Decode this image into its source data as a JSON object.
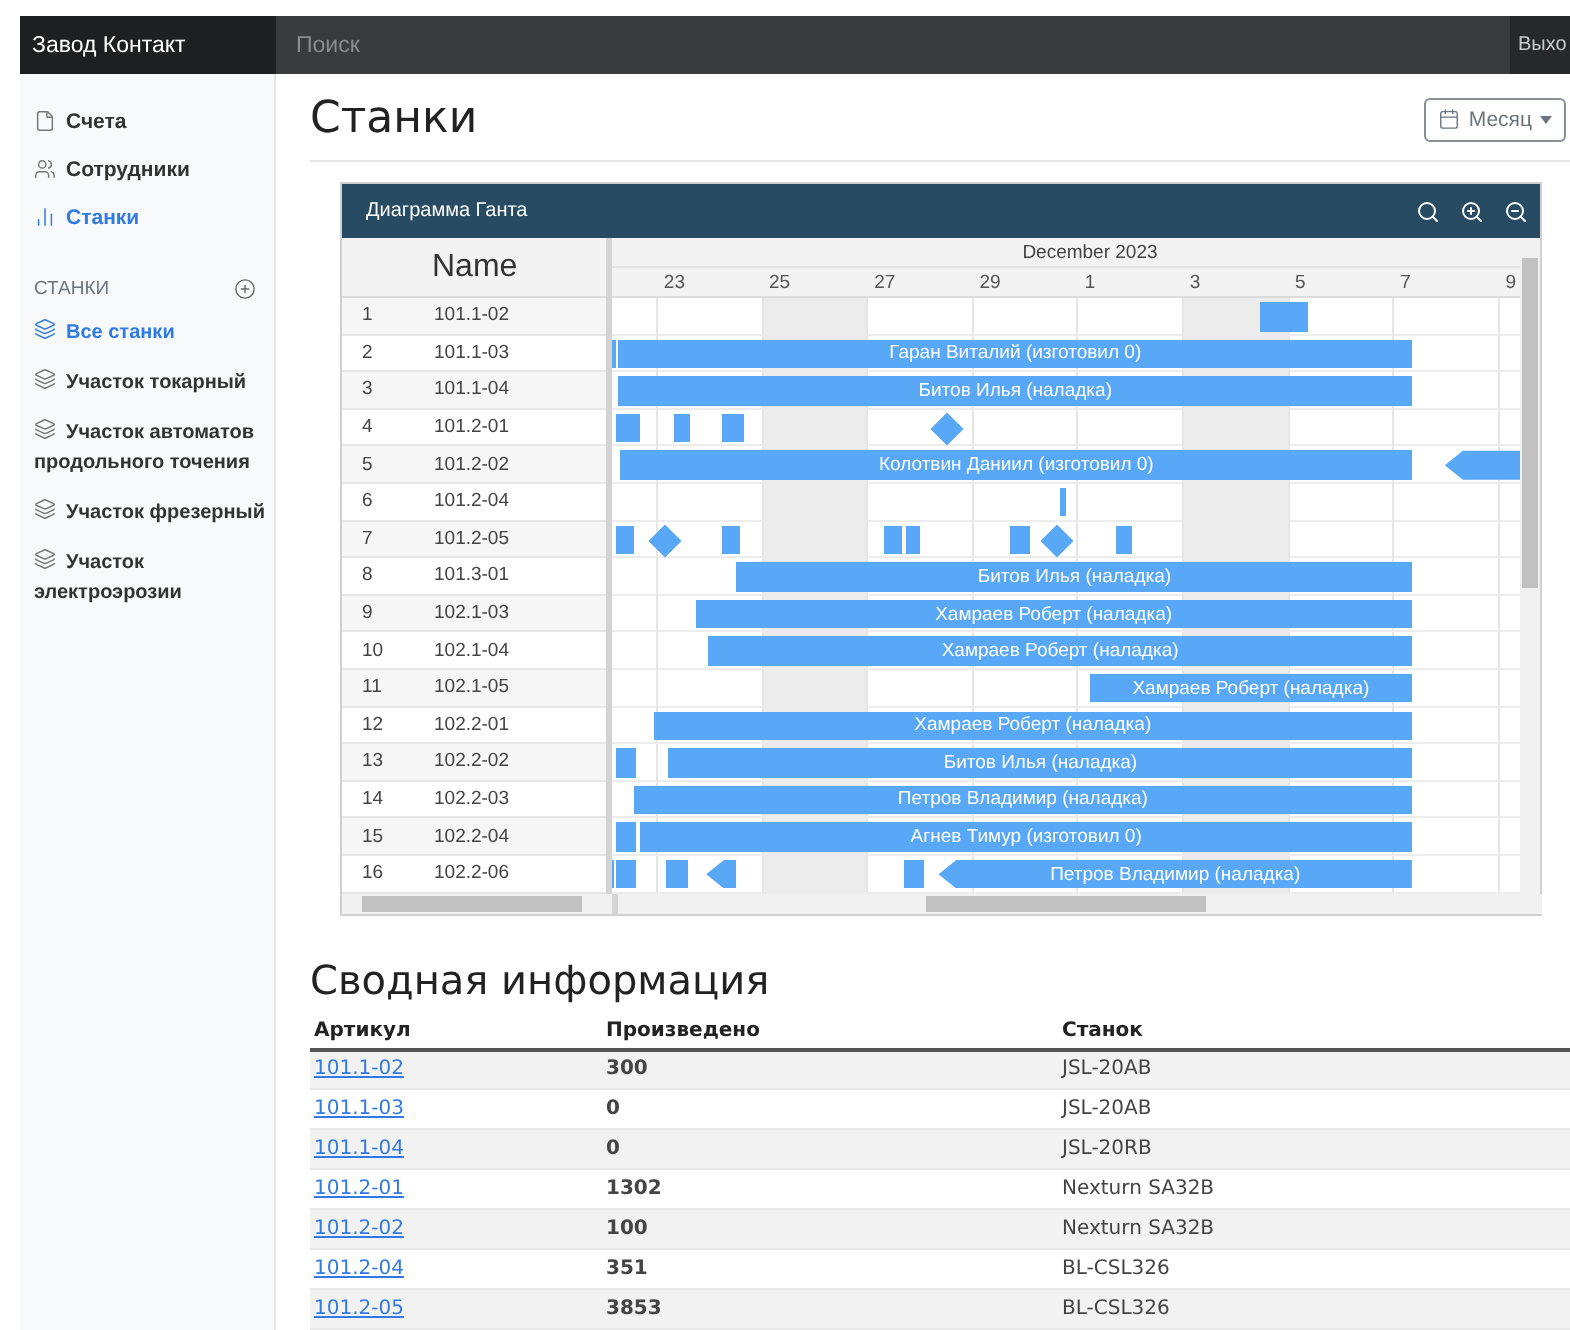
{
  "navbar": {
    "brand": "Завод Контакт",
    "search": {
      "placeholder": "Поиск"
    },
    "exit": "Выхо"
  },
  "sidebar": {
    "items": [
      {
        "label": "Счета",
        "selected": false
      },
      {
        "label": "Сотрудники",
        "selected": false
      },
      {
        "label": "Станки",
        "selected": true
      }
    ],
    "section": {
      "title": "СТАНКИ",
      "groups": [
        {
          "label": "Все станки",
          "selected": true
        },
        {
          "label": "Участок токарный",
          "selected": false
        },
        {
          "label": "Участок автоматов продольного точения",
          "selected": false
        },
        {
          "label": "Участок фрезерный",
          "selected": false
        },
        {
          "label": "Участок электроэрозии",
          "selected": false
        }
      ]
    }
  },
  "page": {
    "title": "Станки",
    "view_button": {
      "label": "Месяц"
    }
  },
  "gantt": {
    "title": "Диаграмма Ганта",
    "grid_header": "Name",
    "month": "December 2023",
    "ticks": [
      {
        "label": "23",
        "shaded": false
      },
      {
        "label": "25",
        "shaded": true
      },
      {
        "label": "27",
        "shaded": false
      },
      {
        "label": "29",
        "shaded": false
      },
      {
        "label": "1",
        "shaded": false
      },
      {
        "label": "3",
        "shaded": true
      },
      {
        "label": "5",
        "shaded": false
      },
      {
        "label": "7",
        "shaded": false
      },
      {
        "label": "9",
        "shaded": false
      }
    ],
    "rows": [
      {
        "number": "1",
        "name": "101.1-02"
      },
      {
        "number": "2",
        "name": "101.1-03",
        "tasks": [
          "Гаран Виталий (изготовил 0)"
        ]
      },
      {
        "number": "3",
        "name": "101.1-04",
        "tasks": [
          "Битов Илья (наладка)"
        ]
      },
      {
        "number": "4",
        "name": "101.2-01"
      },
      {
        "number": "5",
        "name": "101.2-02",
        "tasks": [
          "Колотвин Даниил (изготовил 0)"
        ]
      },
      {
        "number": "6",
        "name": "101.2-04"
      },
      {
        "number": "7",
        "name": "101.2-05"
      },
      {
        "number": "8",
        "name": "101.3-01",
        "tasks": [
          "Битов Илья (наладка)"
        ]
      },
      {
        "number": "9",
        "name": "102.1-03",
        "tasks": [
          "Хамраев Роберт (наладка)"
        ]
      },
      {
        "number": "10",
        "name": "102.1-04",
        "tasks": [
          "Хамраев Роберт (наладка)"
        ]
      },
      {
        "number": "11",
        "name": "102.1-05",
        "tasks": [
          "Хамраев Роберт (наладка)"
        ]
      },
      {
        "number": "12",
        "name": "102.2-01",
        "tasks": [
          "Хамраев Роберт (наладка)"
        ]
      },
      {
        "number": "13",
        "name": "102.2-02",
        "tasks": [
          "Битов Илья (наладка)"
        ]
      },
      {
        "number": "14",
        "name": "102.2-03",
        "tasks": [
          "Петров Владимир (наладка)"
        ]
      },
      {
        "number": "15",
        "name": "102.2-04",
        "tasks": [
          "Агнев Тимур (изготовил 0)"
        ]
      },
      {
        "number": "16",
        "name": "102.2-06",
        "tasks": [
          "Петров Владимир (наладка)"
        ]
      }
    ]
  },
  "summary": {
    "title": "Сводная информация",
    "columns": [
      "Артикул",
      "Произведено",
      "Станок"
    ],
    "rows": [
      {
        "article": "101.1-02",
        "produced": "300",
        "machine": "JSL-20AB"
      },
      {
        "article": "101.1-03",
        "produced": "0",
        "machine": "JSL-20AB"
      },
      {
        "article": "101.1-04",
        "produced": "0",
        "machine": "JSL-20RB"
      },
      {
        "article": "101.2-01",
        "produced": "1302",
        "machine": "Nexturn SA32B"
      },
      {
        "article": "101.2-02",
        "produced": "100",
        "machine": "Nexturn SA32B"
      },
      {
        "article": "101.2-04",
        "produced": "351",
        "machine": "BL-CSL326"
      },
      {
        "article": "101.2-05",
        "produced": "3853",
        "machine": "BL-CSL326"
      }
    ]
  }
}
